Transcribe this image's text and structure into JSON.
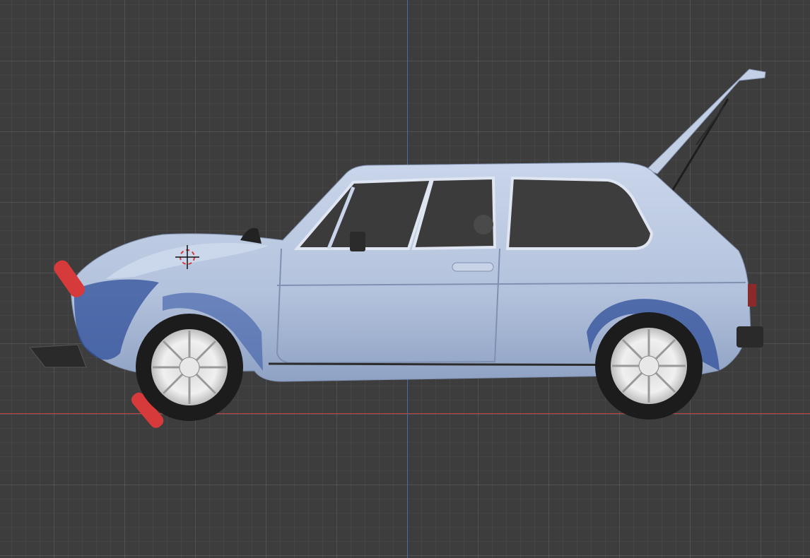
{
  "viewport": {
    "background": "#3d3d3d",
    "axis_x_color": "#b8433f",
    "axis_z_color": "#4a6aa8"
  },
  "scene": {
    "car_body_color": "#b7c5dd",
    "car_shadow_color": "#2f4f9a",
    "tire_color": "#1c1c1c",
    "rim_color": "#e6e6e6",
    "clamp_color": "#d63a3a",
    "cursor_icon": "3d-cursor-icon"
  }
}
